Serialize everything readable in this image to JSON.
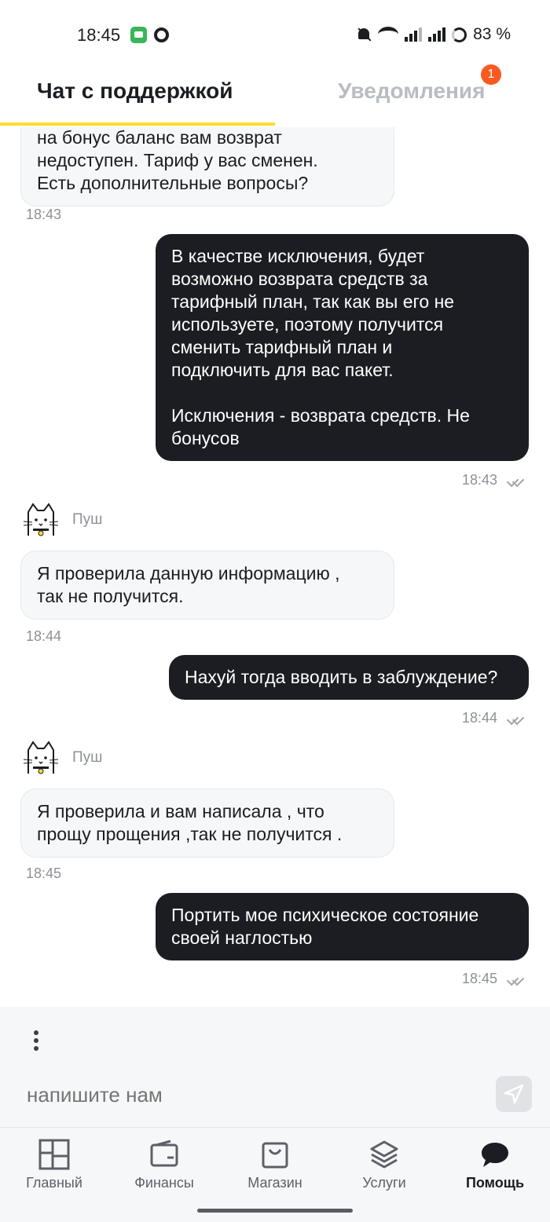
{
  "status_bar": {
    "time": "18:45",
    "battery": "83 %"
  },
  "header": {
    "tab_chat": "Чат с поддержкой",
    "tab_notifications": "Уведомления",
    "notifications_badge": "1",
    "accent_color": "#ffdd2d"
  },
  "messages": [
    {
      "direction": "incoming",
      "text": "на бонус баланс вам возврат\nнедоступен. Тариф у вас сменен.\nЕсть дополнительные вопросы?",
      "time": "18:43"
    },
    {
      "direction": "outgoing",
      "text": "В качестве исключения, будет\nвозможно возврата средств за\nтарифный план, так как вы его не\nиспользуете, поэтому получится\nсменить тарифный план и\nподключить для вас пакет.\n\nИсключения - возврата средств. Не\nбонусов",
      "time": "18:43",
      "read": true
    },
    {
      "direction": "incoming",
      "sender": "Пуш",
      "text": "Я проверила данную информацию ,\nтак не получится.",
      "time": "18:44"
    },
    {
      "direction": "outgoing",
      "text": "Нахуй тогда вводить в заблуждение?",
      "time": "18:44",
      "read": true
    },
    {
      "direction": "incoming",
      "sender": "Пуш",
      "text": "Я проверила и вам написала , что\nпрощу прощения ,так не получится .",
      "time": "18:45"
    },
    {
      "direction": "outgoing",
      "text": "Портить мое психическое состояние\nсвоей наглостью",
      "time": "18:45",
      "read": true
    }
  ],
  "composer": {
    "placeholder": "напишите нам"
  },
  "nav": {
    "items": [
      {
        "label": "Главный",
        "icon": "dashboard-icon"
      },
      {
        "label": "Финансы",
        "icon": "wallet-icon"
      },
      {
        "label": "Магазин",
        "icon": "shopping-bag-icon"
      },
      {
        "label": "Услуги",
        "icon": "layers-icon"
      },
      {
        "label": "Помощь",
        "icon": "chat-bubble-icon",
        "active": true
      }
    ]
  },
  "colors": {
    "outgoing_bubble": "#1c1d22",
    "incoming_bubble": "#f6f7f8",
    "badge": "#fa5a1f"
  }
}
